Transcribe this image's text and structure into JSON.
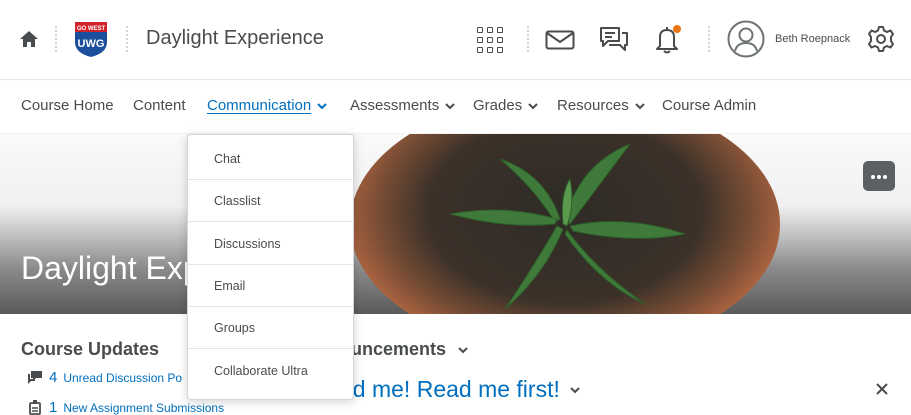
{
  "header": {
    "site_title": "Daylight Experience",
    "logo": {
      "top_text": "GO WEST",
      "main_text": "UWG"
    },
    "user_name": "Beth Roepnack",
    "notification_dot_color": "#e87511"
  },
  "nav": {
    "items": [
      {
        "label": "Course Home",
        "has_menu": false
      },
      {
        "label": "Content",
        "has_menu": false
      },
      {
        "label": "Communication",
        "has_menu": true,
        "active": true
      },
      {
        "label": "Assessments",
        "has_menu": true
      },
      {
        "label": "Grades",
        "has_menu": true
      },
      {
        "label": "Resources",
        "has_menu": true
      },
      {
        "label": "Course Admin",
        "has_menu": false
      }
    ]
  },
  "dropdown": {
    "items": [
      "Chat",
      "Classlist",
      "Discussions",
      "Email",
      "Groups",
      "Collaborate Ultra"
    ]
  },
  "banner": {
    "title": "Daylight Exp"
  },
  "course_updates": {
    "title": "Course Updates",
    "rows": [
      {
        "count": "4",
        "label": "Unread Discussion Po"
      },
      {
        "count": "1",
        "label": "New Assignment Submissions"
      }
    ]
  },
  "announcements": {
    "title": "ouncements",
    "headline": "ad me! Read me first!"
  },
  "colors": {
    "link": "#006fbf",
    "text": "#494c4e"
  }
}
